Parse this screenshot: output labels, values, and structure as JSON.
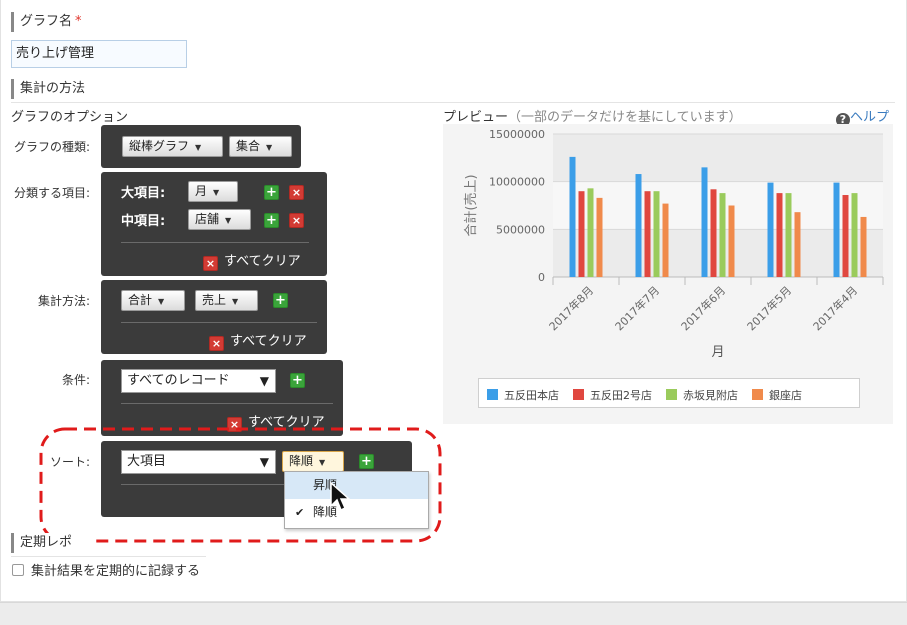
{
  "graph_name": {
    "label": "グラフ名",
    "required_mark": "*",
    "value": "売り上げ管理"
  },
  "aggregation": {
    "section_title": "集計の方法",
    "options_heading": "グラフのオプション",
    "graph_type": {
      "label": "グラフの種類:",
      "chart_kind": "縦棒グラフ",
      "mode": "集合"
    },
    "grouping": {
      "label": "分類する項目:",
      "major_label": "大項目:",
      "major_value": "月",
      "minor_label": "中項目:",
      "minor_value": "店舗",
      "clear_all": "すべてクリア"
    },
    "method": {
      "label": "集計方法:",
      "function": "合計",
      "field": "売上",
      "clear_all": "すべてクリア"
    },
    "condition": {
      "label": "条件:",
      "value": "すべてのレコード",
      "clear_all": "すべてクリア"
    },
    "sort": {
      "label": "ソート:",
      "field": "大項目",
      "order": "降順",
      "menu": [
        {
          "label": "昇順",
          "checked": false,
          "highlighted": true
        },
        {
          "label": "降順",
          "checked": true,
          "highlighted": false
        }
      ]
    },
    "add_symbol": "+",
    "delete_symbol": "×"
  },
  "periodic_report": {
    "section_title": "定期レポ",
    "checkbox_label": "集計結果を定期的に記録する",
    "checked": false
  },
  "preview": {
    "title": "プレビュー",
    "note": "（一部のデータだけを基にしています）",
    "help_label": "ヘルプ",
    "help_icon_glyph": "?"
  },
  "chart_data": {
    "type": "bar",
    "categories": [
      "2017年8月",
      "2017年7月",
      "2017年6月",
      "2017年5月",
      "2017年4月"
    ],
    "series": [
      {
        "name": "五反田本店",
        "color": "#3b9ee8",
        "values": [
          12600000,
          10800000,
          11500000,
          9900000,
          9900000
        ]
      },
      {
        "name": "五反田2号店",
        "color": "#e0473f",
        "values": [
          9000000,
          9000000,
          9200000,
          8800000,
          8600000
        ]
      },
      {
        "name": "赤坂見附店",
        "color": "#9acb5c",
        "values": [
          9300000,
          9000000,
          8800000,
          8800000,
          8800000
        ]
      },
      {
        "name": "銀座店",
        "color": "#f08a4b",
        "values": [
          8300000,
          7700000,
          7500000,
          6800000,
          6300000
        ]
      }
    ],
    "ylabel": "合計(売上)",
    "xlabel": "月",
    "ylim": [
      0,
      15000000
    ],
    "yticks": [
      "15000000",
      "10000000",
      "5000000",
      "0"
    ],
    "grid": true,
    "legend_position": "bottom"
  },
  "colors": {
    "panel": "#3b3b3b",
    "add_button": "#3aa43a",
    "delete_button": "#d33b34",
    "annotation": "#e01b1b"
  }
}
